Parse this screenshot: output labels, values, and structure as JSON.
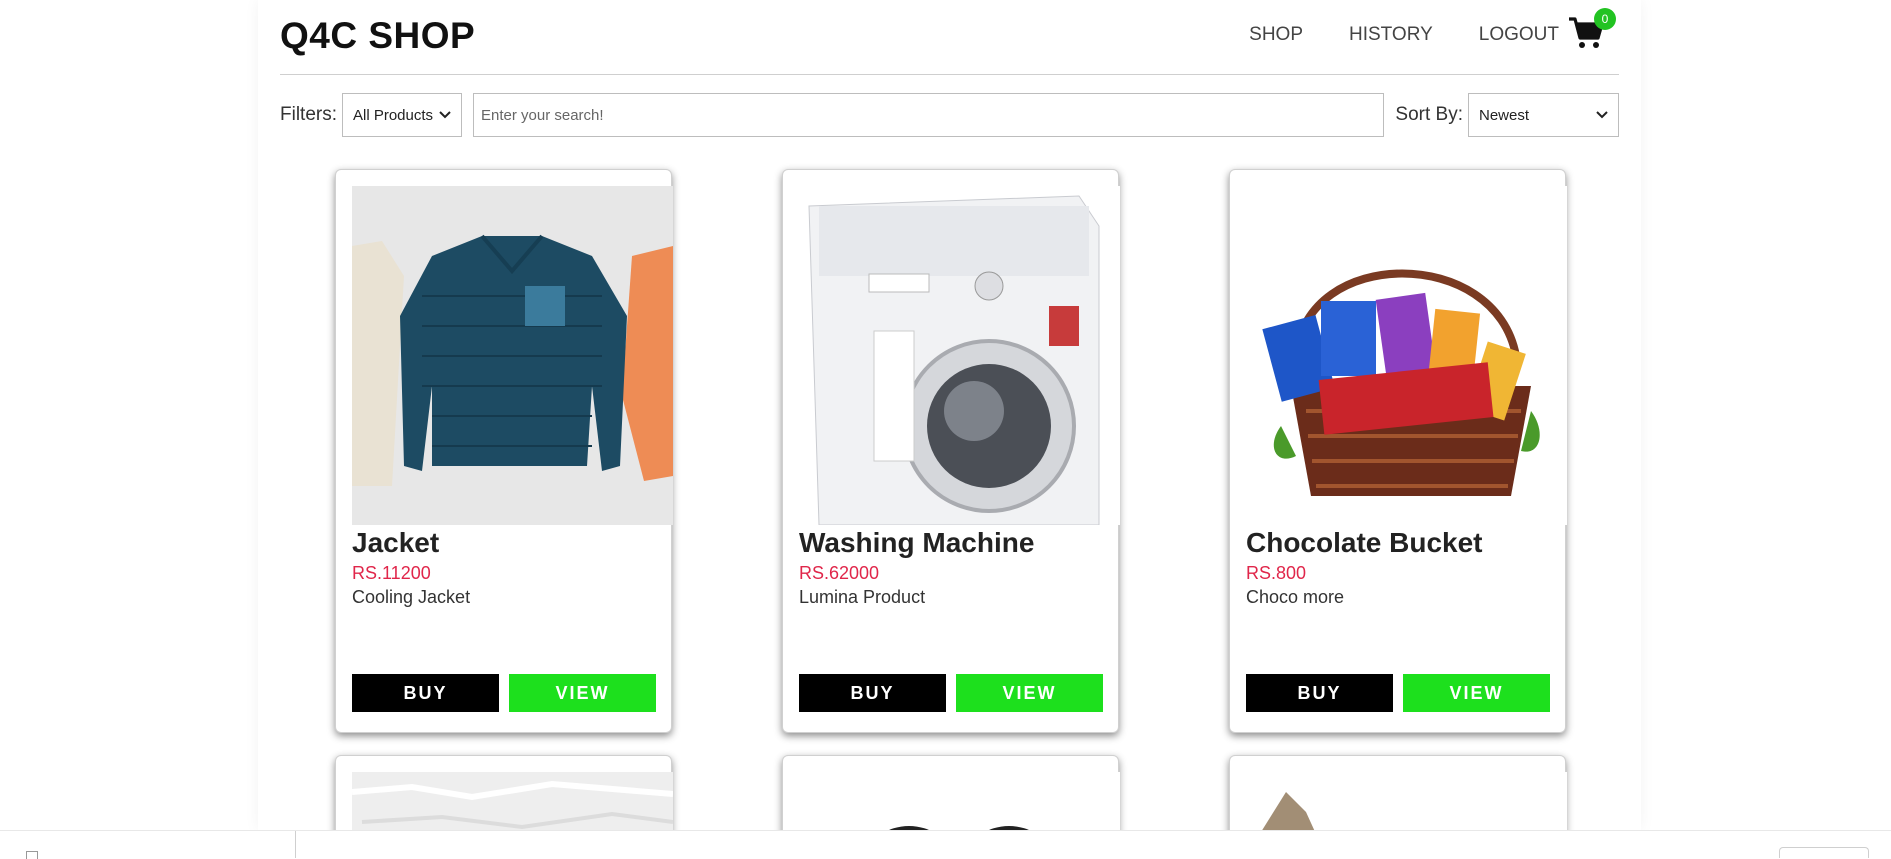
{
  "header": {
    "brand": "Q4C SHOP",
    "nav": [
      "SHOP",
      "HISTORY",
      "LOGOUT"
    ],
    "cart_count": "0",
    "cart_icon": "shopping-cart-icon"
  },
  "filters": {
    "label": "Filters:",
    "category": "All Products",
    "search_placeholder": "Enter your search!",
    "sort_label": "Sort By:",
    "sort_value": "Newest"
  },
  "products": [
    {
      "name": "Jacket",
      "price": "RS.11200",
      "desc": "Cooling Jacket",
      "buy": "BUY",
      "view": "VIEW"
    },
    {
      "name": "Washing Machine",
      "price": "RS.62000",
      "desc": "Lumina Product",
      "buy": "BUY",
      "view": "VIEW"
    },
    {
      "name": "Chocolate Bucket",
      "price": "RS.800",
      "desc": "Choco more",
      "buy": "BUY",
      "view": "VIEW"
    }
  ],
  "colors": {
    "accent_green": "#1de01d",
    "price_red": "#e0264a",
    "buy_black": "#000000"
  }
}
